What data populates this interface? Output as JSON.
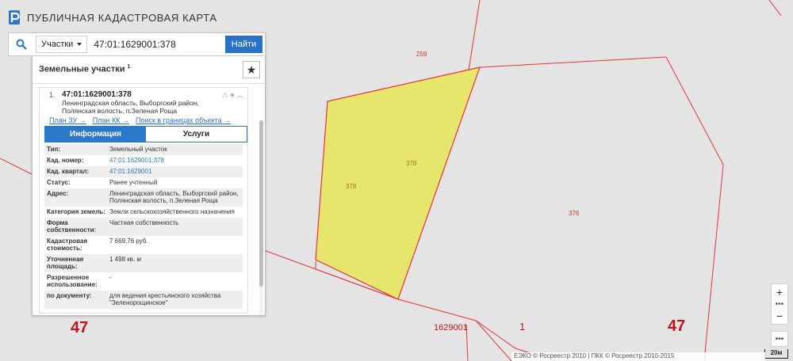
{
  "app": {
    "title": "ПУБЛИЧНАЯ КАДАСТРОВАЯ КАРТА"
  },
  "search": {
    "type_label": "Участки",
    "query": "47:01:1629001:378",
    "button_label": "Найти"
  },
  "panel": {
    "title": "Земельные участки",
    "count": "1"
  },
  "item": {
    "index": "1.",
    "id": "47:01:1629001:378",
    "address": "Ленинградская область, Выборгский район, Полянская волость, п.Зеленая Роща",
    "links": [
      "План ЗУ →",
      "План КК →",
      "Поиск в границах объекта →"
    ],
    "tabs": [
      "Информация",
      "Услуги"
    ],
    "props": [
      {
        "key": "Тип:",
        "value": "Земельный участок",
        "link": false
      },
      {
        "key": "Кад. номер:",
        "value": "47:01:1629001:378",
        "link": true
      },
      {
        "key": "Кад. квартал:",
        "value": "47:01:1629001",
        "link": true
      },
      {
        "key": "Статус:",
        "value": "Ранее учтенный",
        "link": false
      },
      {
        "key": "Адрес:",
        "value": "Ленинградская область, Выборгский район, Полянская волость, п.Зеленая Роща",
        "link": false
      },
      {
        "key": "Категория земель:",
        "value": "Земли сельскохозяйственного назначения",
        "link": false
      },
      {
        "key": "Форма собственности:",
        "value": "Частная собственность",
        "link": false
      },
      {
        "key": "Кадастровая стоимость:",
        "value": "7 669,76 руб.",
        "link": false
      },
      {
        "key": "Уточненная площадь:",
        "value": "1 498 кв. м",
        "link": false
      },
      {
        "key": "Разрешенное использование:",
        "value": "-",
        "link": false
      },
      {
        "key": "по документу:",
        "value": "для ведения крестьянского хозяйства \"Зеленорощинское\"",
        "link": false
      }
    ]
  },
  "map": {
    "labels": {
      "p259": "259",
      "p378a": "378",
      "p378b": "378",
      "p376": "376",
      "district_left": "47",
      "district_right": "47",
      "quarter": "1629001",
      "quarter_num": "1"
    },
    "colors": {
      "boundary": "#e8323a",
      "selected_fill": "#e6e66c",
      "background": "#e4e4e4"
    }
  },
  "controls": {
    "zoom_in": "+",
    "zoom_out": "−",
    "more": "•••",
    "dots": "•••"
  },
  "scale": "20м",
  "attribution": "ЕЭКО © Росреестр 2010 | ПКК © Росреестр 2010-2015"
}
